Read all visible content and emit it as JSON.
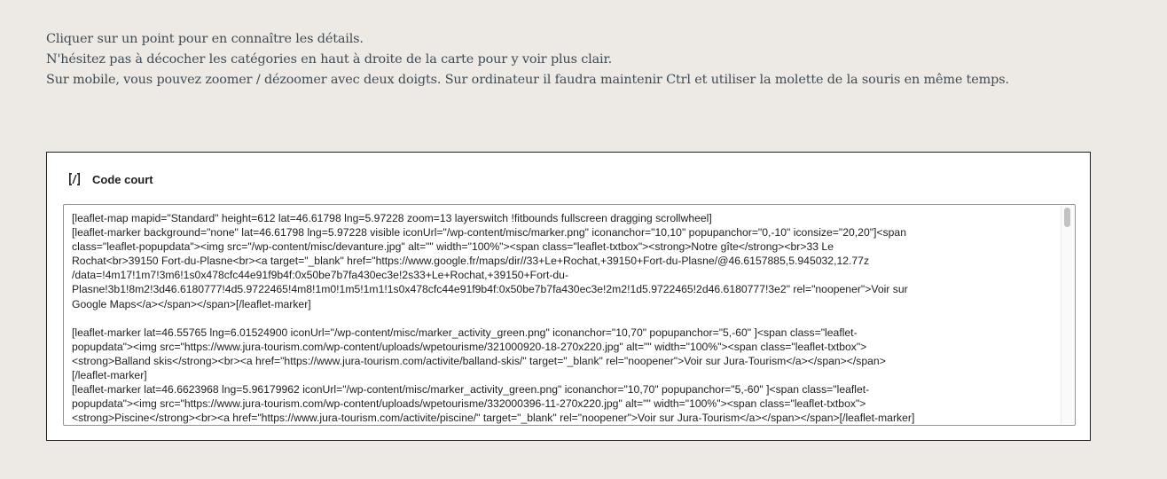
{
  "intro": {
    "lines": [
      "Cliquer sur un point pour en connaître les détails.",
      "N'hésitez pas à décocher les catégories en haut à droite de la carte pour y voir plus clair.",
      "Sur mobile, vous pouvez zoomer / dézoomer avec deux doigts. Sur ordinateur il faudra maintenir Ctrl et utiliser la molette de la souris en même temps."
    ]
  },
  "shortcode_block": {
    "icon": "shortcode-icon",
    "title": "Code court",
    "code_lines": [
      "[leaflet-map mapid=\"Standard\" height=612 lat=46.61798 lng=5.97228 zoom=13 layerswitch !fitbounds fullscreen dragging scrollwheel]",
      "[leaflet-marker background=\"none\" lat=46.61798 lng=5.97228 visible iconUrl=\"/wp-content/misc/marker.png\" iconanchor=\"10,10\" popupanchor=\"0,-10\" iconsize=\"20,20\"]<span",
      "class=\"leaflet-popupdata\"><img src=\"/wp-content/misc/devanture.jpg\" alt=\"\" width=\"100%\"><span class=\"leaflet-txtbox\"><strong>Notre gîte</strong><br>33 Le",
      "Rochat<br>39150 Fort-du-Plasne<br><a target=\"_blank\" href=\"https://www.google.fr/maps/dir//33+Le+Rochat,+39150+Fort-du-Plasne/@46.6157885,5.945032,12.77z",
      "/data=!4m17!1m7!3m6!1s0x478cfc44e91f9b4f:0x50be7b7fa430ec3e!2s33+Le+Rochat,+39150+Fort-du-",
      "Plasne!3b1!8m2!3d46.6180777!4d5.9722465!4m8!1m0!1m5!1m1!1s0x478cfc44e91f9b4f:0x50be7b7fa430ec3e!2m2!1d5.9722465!2d46.6180777!3e2\" rel=\"noopener\">Voir sur",
      "Google Maps</a></span></span>[/leaflet-marker]",
      "",
      "[leaflet-marker lat=46.55765 lng=6.01524900 iconUrl=\"/wp-content/misc/marker_activity_green.png\" iconanchor=\"10,70\" popupanchor=\"5,-60\" ]<span class=\"leaflet-",
      "popupdata\"><img src=\"https://www.jura-tourism.com/wp-content/uploads/wpetourisme/321000920-18-270x220.jpg\" alt=\"\" width=\"100%\"><span class=\"leaflet-txtbox\">",
      "<strong>Balland skis</strong><br><a href=\"https://www.jura-tourism.com/activite/balland-skis/\" target=\"_blank\" rel=\"noopener\">Voir sur Jura-Tourism</a></span></span>",
      "[/leaflet-marker]",
      "[leaflet-marker lat=46.6623968 lng=5.96179962 iconUrl=\"/wp-content/misc/marker_activity_green.png\" iconanchor=\"10,70\" popupanchor=\"5,-60\" ]<span class=\"leaflet-",
      "popupdata\"><img src=\"https://www.jura-tourism.com/wp-content/uploads/wpetourisme/332000396-11-270x220.jpg\" alt=\"\" width=\"100%\"><span class=\"leaflet-txtbox\">",
      "<strong>Piscine</strong><br><a href=\"https://www.jura-tourism.com/activite/piscine/\" target=\"_blank\" rel=\"noopener\">Voir sur Jura-Tourism</a></span></span>[/leaflet-marker]"
    ]
  }
}
